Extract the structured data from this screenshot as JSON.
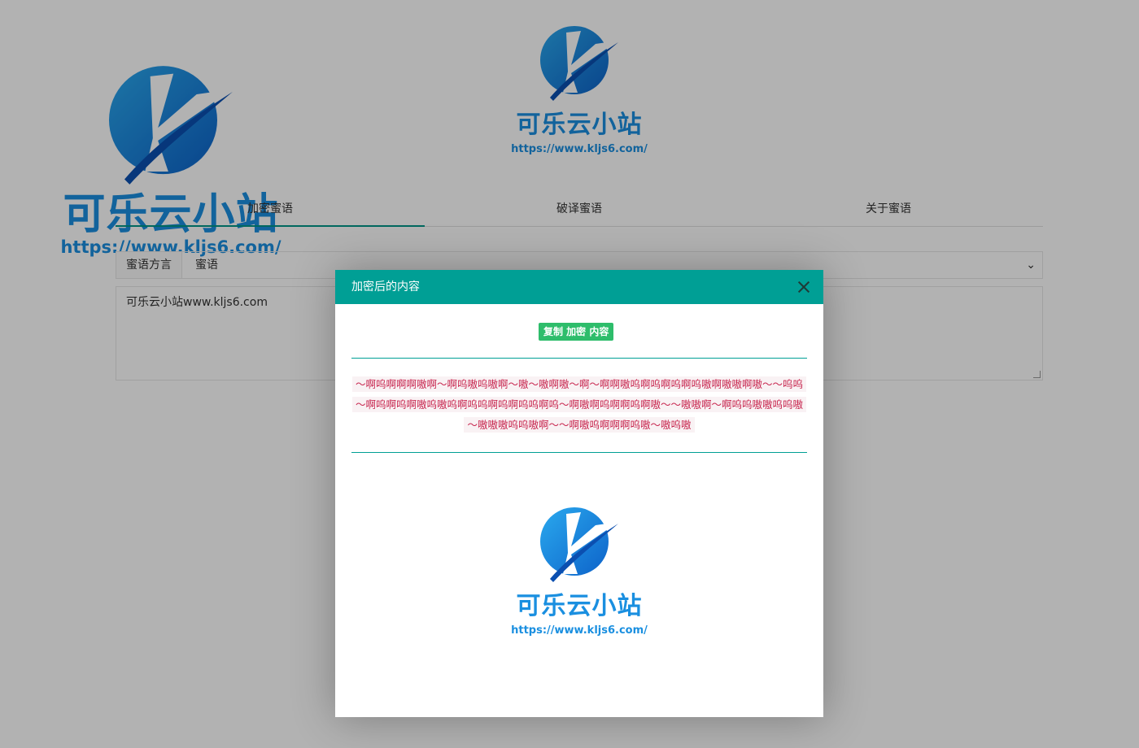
{
  "brand": {
    "name": "可乐云小站",
    "url": "https://www.kljs6.com/",
    "color_primary": "#1a8fe0",
    "color_light": "#29a9ef"
  },
  "tabs": [
    {
      "label": "加密蜜语",
      "active": true
    },
    {
      "label": "破译蜜语",
      "active": false
    },
    {
      "label": "关于蜜语",
      "active": false
    }
  ],
  "form": {
    "label": "蜜语方言",
    "select_value": "蜜语",
    "textarea_value": "可乐云小站www.kljs6.com"
  },
  "modal": {
    "title": "加密后的内容",
    "copy_button": "复制 加密 内容",
    "cipher_text": "～啊呜啊啊啊嗷啊～啊呜嗷呜嗷啊～嗷～嗷啊嗷～啊～啊啊嗷呜啊呜啊呜啊呜嗷啊嗷嗷啊嗷～～呜呜～啊呜啊呜啊嗷呜嗷呜啊呜呜啊呜啊呜呜啊呜～啊嗷啊呜啊啊呜啊嗷～～嗷嗷啊～啊呜呜嗷嗷呜呜嗷～嗷嗷嗷呜呜嗷啊～～啊嗷呜啊啊啊呜嗷～嗷呜嗷",
    "accent_color": "#009f95"
  }
}
